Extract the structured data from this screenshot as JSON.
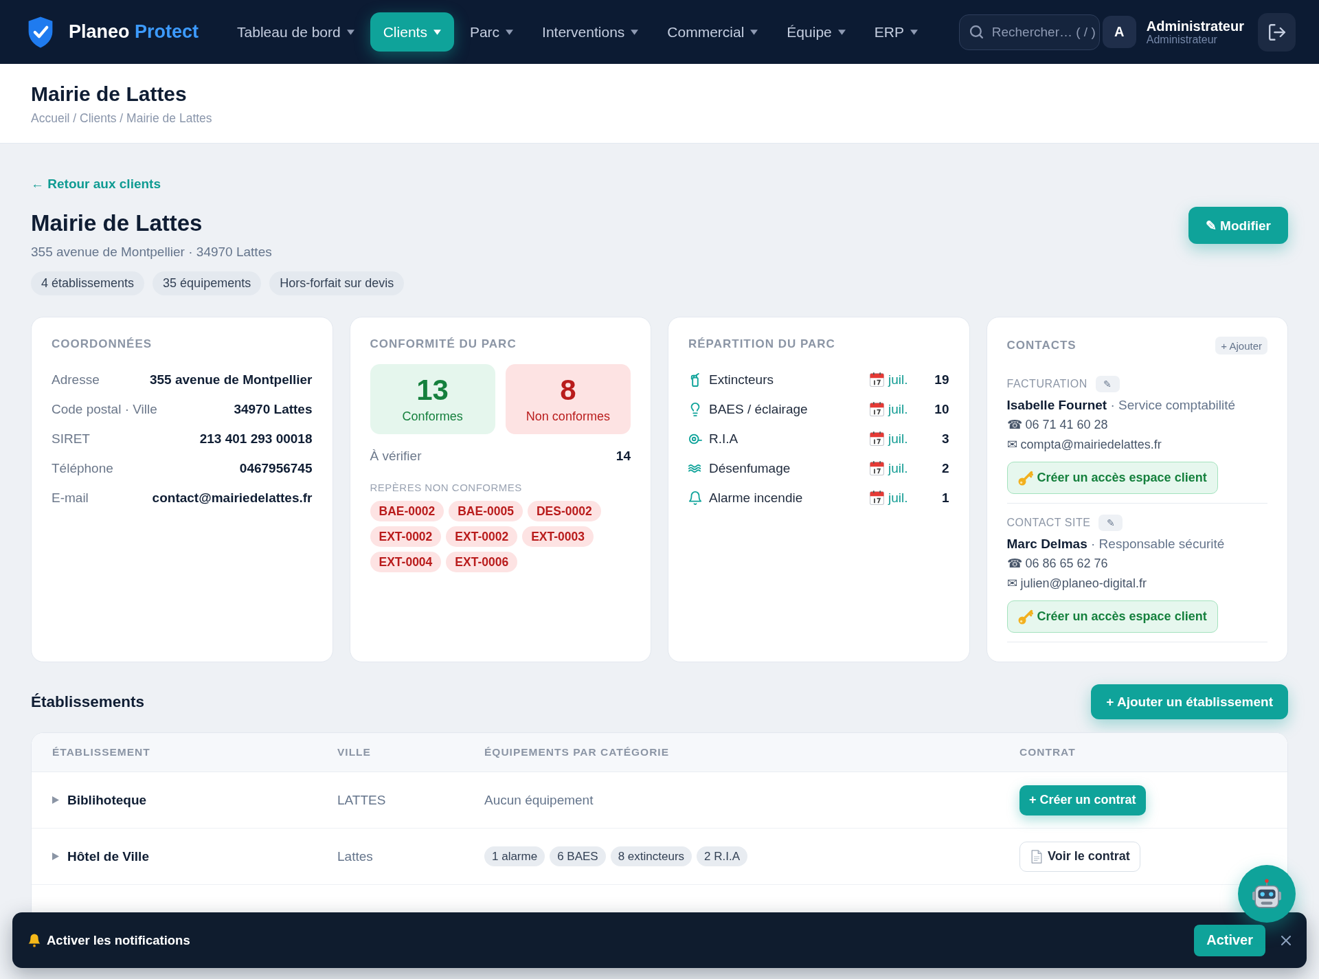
{
  "header": {
    "brand": {
      "name": "Planeo",
      "accent": "Protect"
    },
    "nav": [
      {
        "label": "Tableau de bord",
        "selected": false
      },
      {
        "label": "Clients",
        "selected": true
      },
      {
        "label": "Parc",
        "selected": false
      },
      {
        "label": "Interventions",
        "selected": false
      },
      {
        "label": "Commercial",
        "selected": false
      },
      {
        "label": "Équipe",
        "selected": false
      },
      {
        "label": "ERP",
        "selected": false
      }
    ],
    "search": {
      "placeholder": "Rechercher… ( / )"
    },
    "user": {
      "initial": "A",
      "name": "Administrateur",
      "role": "Administrateur"
    }
  },
  "page_header": {
    "title": "Mairie de Lattes",
    "breadcrumb": "Accueil / Clients / Mairie de Lattes"
  },
  "client": {
    "back_link": "← Retour aux clients",
    "name": "Mairie de Lattes",
    "address": "355 avenue de Montpellier · 34970 Lattes",
    "chips": [
      "4 établissements",
      "35 équipements",
      "Hors-forfait sur devis"
    ],
    "edit_button": "✎ Modifier"
  },
  "coordinates": {
    "title": "COORDONNÉES",
    "rows": [
      {
        "label": "Adresse",
        "value": "355 avenue de Montpellier"
      },
      {
        "label": "Code postal · Ville",
        "value": "34970 Lattes"
      },
      {
        "label": "SIRET",
        "value": "213 401 293 00018"
      },
      {
        "label": "Téléphone",
        "value": "0467956745"
      },
      {
        "label": "E-mail",
        "value": "contact@mairiedelattes.fr"
      }
    ]
  },
  "compliance": {
    "title": "CONFORMITÉ DU PARC",
    "tiles": [
      {
        "kind": "compliant",
        "count": "13",
        "label": "Conformes"
      },
      {
        "kind": "non_compliant",
        "count": "8",
        "label": "Non conformes"
      }
    ],
    "to_check": {
      "label": "À vérifier",
      "value": "14"
    },
    "tags_title": "REPÈRES NON CONFORMES",
    "tags": [
      "BAE-0002",
      "BAE-0005",
      "DES-0002",
      "EXT-0002",
      "EXT-0002",
      "EXT-0003",
      "EXT-0004",
      "EXT-0006"
    ]
  },
  "distribution": {
    "title": "RÉPARTITION DU PARC",
    "rows": [
      {
        "kind": "extinguisher",
        "label": "Extincteurs",
        "date": "juil.",
        "count": "19"
      },
      {
        "kind": "lighting",
        "label": "BAES / éclairage",
        "date": "juil.",
        "count": "10"
      },
      {
        "kind": "hose",
        "label": "R.I.A",
        "date": "juil.",
        "count": "3"
      },
      {
        "kind": "smoke",
        "label": "Désenfumage",
        "date": "juil.",
        "count": "2"
      },
      {
        "kind": "alarm",
        "label": "Alarme incendie",
        "date": "juil.",
        "count": "1"
      }
    ]
  },
  "contacts": {
    "title": "CONTACTS",
    "add_button": "+ Ajouter",
    "items": [
      {
        "role": "FACTURATION",
        "edit_button": "✎",
        "name_line": "**Isabelle Fournet** · Service comptabilité",
        "phone": "☎ 06 71 41 60 28",
        "email": "✉ compta@mairiedelattes.fr",
        "access_button": "Créer un accès espace client"
      },
      {
        "role": "CONTACT SITE",
        "edit_button": "✎",
        "name_line": "**Marc Delmas** · Responsable sécurité",
        "phone": "☎ 06 86 65 62 76",
        "email": "✉ julien@planeo-digital.fr",
        "access_button": "Créer un accès espace client"
      }
    ]
  },
  "establishments": {
    "title": "Établissements",
    "add_button": "+ Ajouter un établissement",
    "columns": [
      "ÉTABLISSEMENT",
      "VILLE",
      "ÉQUIPEMENTS PAR CATÉGORIE",
      "CONTRAT"
    ],
    "rows": [
      {
        "expanded": false,
        "name": "Biblihoteque",
        "city": "LATTES",
        "equipment_note": "Aucun équipement",
        "contract": {
          "kind": "create",
          "label": "+ Créer un contrat"
        }
      },
      {
        "expanded": false,
        "name": "Hôtel de Ville",
        "city": "Lattes",
        "equipment": [
          "1 alarme",
          "6 BAES",
          "8 extincteurs",
          "2 R.I.A"
        ],
        "contract": {
          "kind": "view",
          "label": "Voir le contrat"
        }
      }
    ]
  },
  "notification": {
    "text": "Activer les notifications",
    "button": "Activer"
  }
}
